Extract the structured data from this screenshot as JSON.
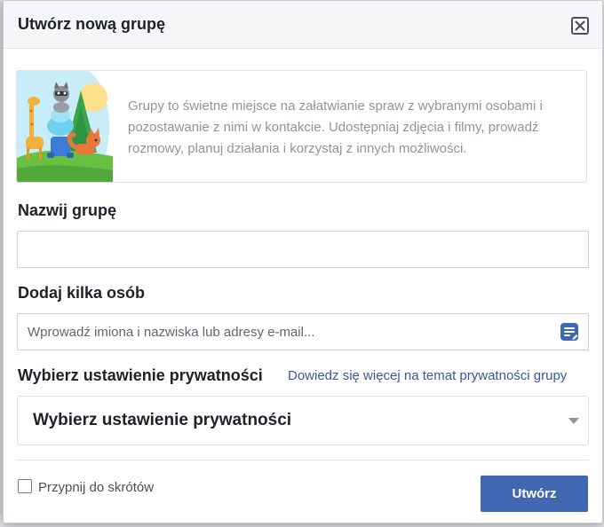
{
  "modal": {
    "title": "Utwórz nową grupę",
    "close_icon": "close-icon"
  },
  "info": {
    "text": "Grupy to świetne miejsce na załatwianie spraw z wybranymi osobami i pozostawanie z nimi w kontakcie. Udostępniaj zdjęcia i filmy, prowadź rozmowy, planuj działania i korzystaj z innych możliwości."
  },
  "group_name": {
    "label": "Nazwij grupę",
    "value": "",
    "placeholder": ""
  },
  "add_people": {
    "label": "Dodaj kilka osób",
    "value": "",
    "placeholder": "Wprowadź imiona i nazwiska lub adresy e-mail...",
    "icon": "address-book-icon"
  },
  "privacy": {
    "label": "Wybierz ustawienie prywatności",
    "link": "Dowiedz się więcej na temat prywatności grupy",
    "selected": "Wybierz ustawienie prywatności"
  },
  "footer": {
    "pin_label": "Przypnij do skrótów",
    "pin_checked": false,
    "create_label": "Utwórz"
  },
  "colors": {
    "primary_button": "#4267b2",
    "link": "#385898",
    "title_text": "#1d2129",
    "muted_text": "#90949c"
  }
}
